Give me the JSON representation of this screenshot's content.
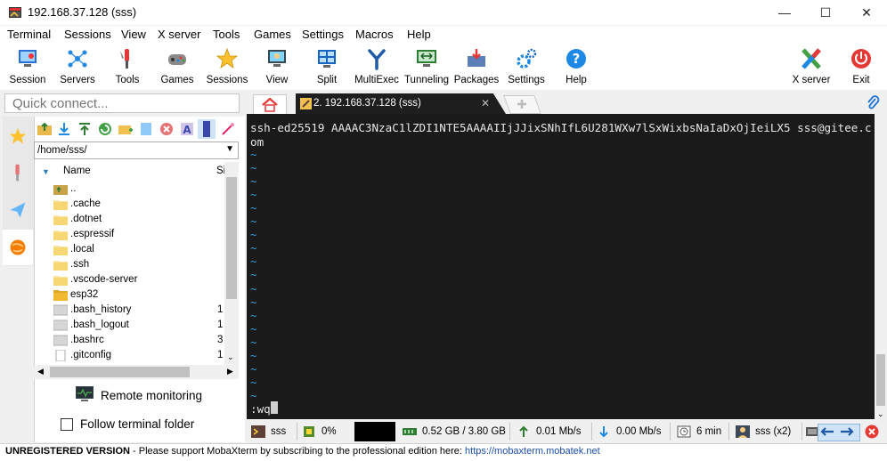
{
  "window": {
    "title": "192.168.37.128 (sss)"
  },
  "menu": [
    "Terminal",
    "Sessions",
    "View",
    "X server",
    "Tools",
    "Games",
    "Settings",
    "Macros",
    "Help"
  ],
  "toolbar": {
    "left": [
      {
        "label": "Session",
        "icon": "session-icon"
      },
      {
        "label": "Servers",
        "icon": "servers-icon"
      },
      {
        "label": "Tools",
        "icon": "tools-icon"
      },
      {
        "label": "Games",
        "icon": "games-icon"
      },
      {
        "label": "Sessions",
        "icon": "sessions-star-icon"
      },
      {
        "label": "View",
        "icon": "view-icon"
      },
      {
        "label": "Split",
        "icon": "split-icon"
      },
      {
        "label": "MultiExec",
        "icon": "multiexec-icon"
      },
      {
        "label": "Tunneling",
        "icon": "tunneling-icon"
      },
      {
        "label": "Packages",
        "icon": "packages-icon"
      },
      {
        "label": "Settings",
        "icon": "settings-icon"
      },
      {
        "label": "Help",
        "icon": "help-icon"
      }
    ],
    "right": [
      {
        "label": "X server",
        "icon": "x-server-icon"
      },
      {
        "label": "Exit",
        "icon": "exit-icon"
      }
    ]
  },
  "quick_connect": {
    "placeholder": "Quick connect..."
  },
  "sftp": {
    "path": "/home/sss/",
    "columns": {
      "name": "Name",
      "size": "Si"
    },
    "files": [
      {
        "name": "..",
        "type": "parent",
        "size": ""
      },
      {
        "name": ".cache",
        "type": "folder",
        "size": ""
      },
      {
        "name": ".dotnet",
        "type": "folder",
        "size": ""
      },
      {
        "name": ".espressif",
        "type": "folder",
        "size": ""
      },
      {
        "name": ".local",
        "type": "folder",
        "size": ""
      },
      {
        "name": ".ssh",
        "type": "folder",
        "size": ""
      },
      {
        "name": ".vscode-server",
        "type": "folder",
        "size": ""
      },
      {
        "name": "esp32",
        "type": "folder-solid",
        "size": ""
      },
      {
        "name": ".bash_history",
        "type": "file",
        "size": "1"
      },
      {
        "name": ".bash_logout",
        "type": "file",
        "size": "1"
      },
      {
        "name": ".bashrc",
        "type": "file",
        "size": "3"
      },
      {
        "name": ".gitconfig",
        "type": "doc",
        "size": "1"
      }
    ],
    "remote_monitoring": "Remote monitoring",
    "follow_terminal": {
      "label": "Follow terminal folder",
      "checked": false
    }
  },
  "tabs": {
    "active_label": "2. 192.168.37.128 (sss)"
  },
  "terminal": {
    "content": "ssh-ed25519 AAAAC3NzaC1lZDI1NTE5AAAAIIjJJixSNhIfL6U281WXw7lSxWixbsNaIaDxOjIeiLX5 sss@gitee.com",
    "tilde": "~",
    "command": ":wq"
  },
  "status": {
    "session": "sss",
    "cpu": "0%",
    "memory": "0.52 GB / 3.80 GB",
    "upload": "0.01 Mb/s",
    "download": "0.00 Mb/s",
    "uptime": "6 min",
    "users": "sss (x2)"
  },
  "footer": {
    "unregistered": "UNREGISTERED VERSION",
    "message": "  -  Please support MobaXterm by subscribing to the professional edition here:",
    "link": "https://mobaxterm.mobatek.net"
  },
  "colors": {
    "terminal_bg": "#1a1a1a",
    "tilde": "#2b9bd3",
    "folder": "#f7d774",
    "link": "#1b4fa8"
  }
}
